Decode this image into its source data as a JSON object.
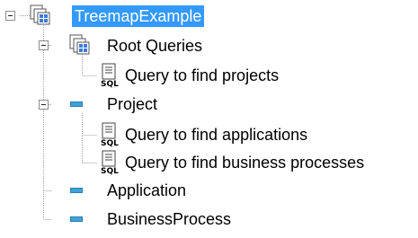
{
  "tree": {
    "root": {
      "label": "TreemapExample",
      "selected": true,
      "icon": "queries-folder-icon"
    },
    "root_queries": {
      "label": "Root Queries",
      "icon": "queries-folder-icon"
    },
    "query_projects": {
      "label": "Query to find projects",
      "icon": "sql-query-icon"
    },
    "project": {
      "label": "Project",
      "icon": "class-icon"
    },
    "query_applications": {
      "label": "Query to find applications",
      "icon": "sql-query-icon"
    },
    "query_business": {
      "label": "Query to find business processes",
      "icon": "sql-query-icon"
    },
    "application": {
      "label": "Application",
      "icon": "class-icon"
    },
    "business_process": {
      "label": "BusinessProcess",
      "icon": "class-icon"
    }
  },
  "sql_icon_text": "SQL",
  "colors": {
    "selection": "#3399ff",
    "class_icon": "#3fa2d8",
    "lines": "#a0a0a0"
  }
}
